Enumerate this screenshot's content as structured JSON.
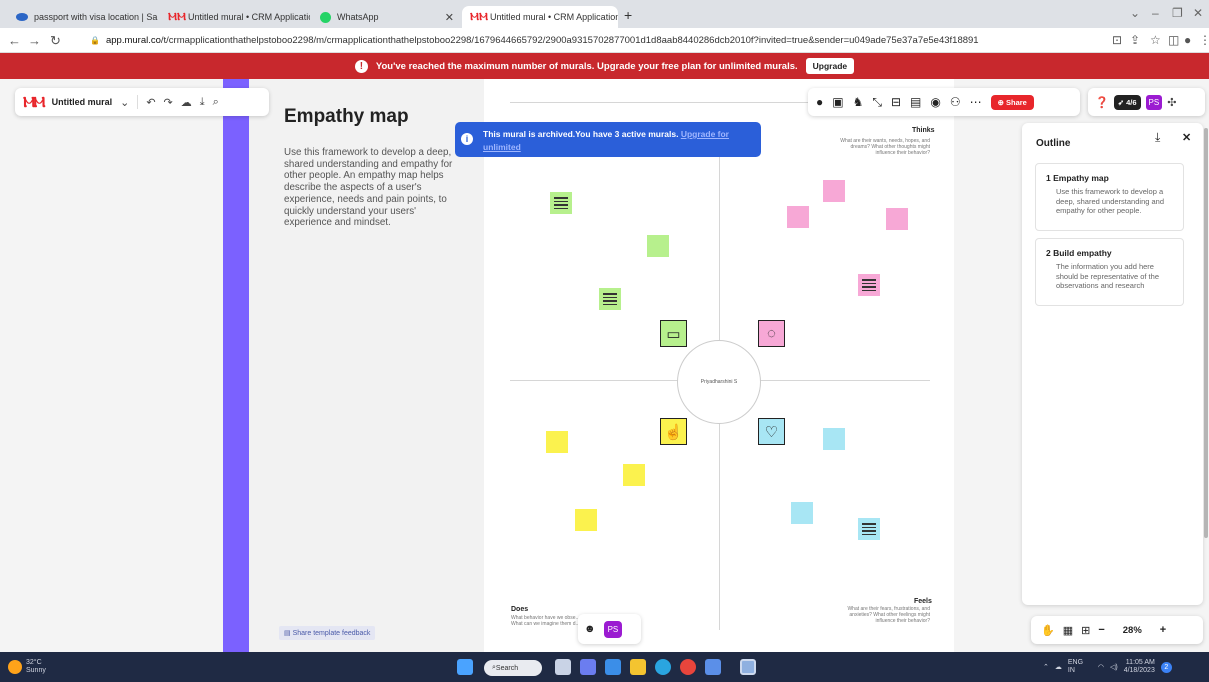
{
  "browser": {
    "tabs": [
      {
        "title": "passport with visa location | Sale"
      },
      {
        "title": "Untitled mural • CRM Application"
      },
      {
        "title": "WhatsApp"
      },
      {
        "title": "Untitled mural • CRM Application"
      }
    ],
    "url_domain": "app.mural.co",
    "url_path": "/t/crmapplicationthathelpstoboo2298/m/crmapplicationthathelpstoboo2298/1679644665792/2900a9315702877001d1d8aab8440286dcb2010f?invited=true&sender=u049ade75e37a7e5e43f18891"
  },
  "banner": {
    "message": "You've reached the maximum number of murals. Upgrade your free plan for unlimited murals.",
    "button": "Upgrade"
  },
  "toolbar": {
    "mural_name": "Untitled mural",
    "share": "Share",
    "timer": "4/6",
    "avatar": "PS"
  },
  "archived": {
    "text": "This mural is archived.You have 3 active murals.",
    "link": "Upgrade for unlimited"
  },
  "template": {
    "title": "Empathy map",
    "description": "Use this framework to develop a deep, shared understanding and empathy for other people. An empathy map helps describe the aspects of a user's experience, needs and pain points, to quickly understand your users' experience and mindset.",
    "feedback": "Share template feedback"
  },
  "board": {
    "thinks_title": "Thinks",
    "thinks_desc": "What are their wants, needs, hopes, and dreams? What other thoughts might influence their behavior?",
    "feels_title": "Feels",
    "feels_desc": "What are their fears, frustrations, and anxieties? What other feelings might influence their behavior?",
    "does_title": "Does",
    "does_desc": "What behavior have we obse... What can we imagine them d...",
    "center": "Priyadharshini S"
  },
  "outline": {
    "title": "Outline",
    "items": [
      {
        "heading": "1   Empathy map",
        "desc": "Use this framework to develop a deep, shared understanding and empathy for other people."
      },
      {
        "heading": "2   Build empathy",
        "desc": "The information you add here should be representative of the observations and research"
      }
    ]
  },
  "zoom": "28%",
  "bottom_avatar": "PS",
  "taskbar": {
    "temp": "32°C",
    "weather": "Sunny",
    "search": "Search",
    "lang": "ENG IN",
    "time": "11:05 AM",
    "date": "4/18/2023"
  }
}
